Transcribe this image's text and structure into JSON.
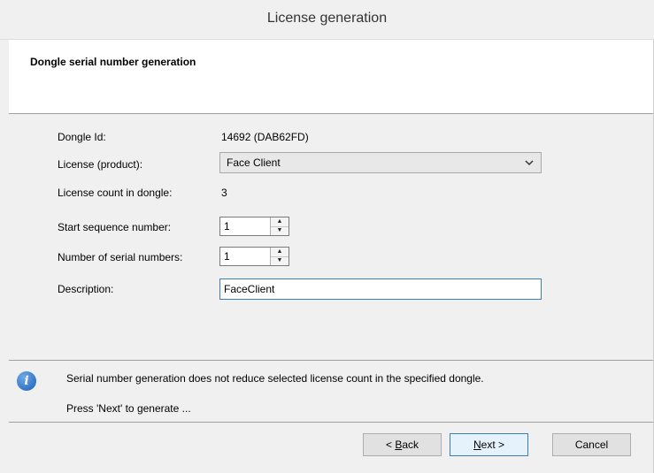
{
  "window": {
    "title": "License generation"
  },
  "header": {
    "title": "Dongle serial number generation"
  },
  "form": {
    "dongle_id_label": "Dongle Id:",
    "dongle_id_value": "14692 (DAB62FD)",
    "license_label": "License (product):",
    "license_value": "Face Client",
    "license_count_label": "License count in dongle:",
    "license_count_value": "3",
    "start_seq_label": "Start sequence number:",
    "start_seq_value": "1",
    "num_serials_label": "Number of serial numbers:",
    "num_serials_value": "1",
    "description_label": "Description:",
    "description_value": "FaceClient"
  },
  "info": {
    "message": "Serial number generation does not reduce selected license count in the specified dongle.",
    "hint": "Press 'Next' to generate ..."
  },
  "buttons": {
    "back_prefix": "< ",
    "back_accel": "B",
    "back_rest": "ack",
    "next_accel": "N",
    "next_rest": "ext >",
    "cancel": "Cancel"
  },
  "icons": {
    "info": "info-icon",
    "dropdown": "chevron-down-icon",
    "spin_up": "spin-up-icon",
    "spin_down": "spin-down-icon"
  }
}
